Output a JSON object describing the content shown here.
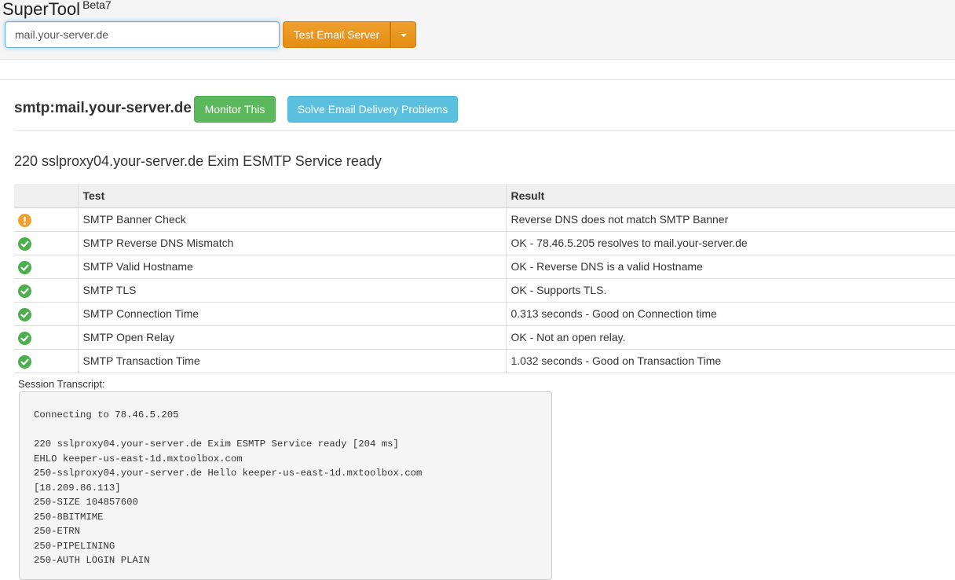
{
  "header": {
    "brand": "SuperTool",
    "brand_version": "Beta7",
    "search_value": "mail.your-server.de",
    "test_button_label": "Test Email Server"
  },
  "result": {
    "title": "smtp:mail.your-server.de",
    "monitor_button_label": "Monitor This",
    "solve_button_label": "Solve Email Delivery Problems",
    "banner": "220 sslproxy04.your-server.de Exim ESMTP Service ready"
  },
  "table": {
    "headers": [
      "",
      "Test",
      "Result"
    ],
    "rows": [
      {
        "status": "warning",
        "test": "SMTP Banner Check",
        "result": "Reverse DNS does not match SMTP Banner"
      },
      {
        "status": "ok",
        "test": "SMTP Reverse DNS Mismatch",
        "result": "OK - 78.46.5.205 resolves to mail.your-server.de"
      },
      {
        "status": "ok",
        "test": "SMTP Valid Hostname",
        "result": "OK - Reverse DNS is a valid Hostname"
      },
      {
        "status": "ok",
        "test": "SMTP TLS",
        "result": "OK - Supports TLS."
      },
      {
        "status": "ok",
        "test": "SMTP Connection Time",
        "result": "0.313 seconds - Good on Connection time"
      },
      {
        "status": "ok",
        "test": "SMTP Open Relay",
        "result": "OK - Not an open relay."
      },
      {
        "status": "ok",
        "test": "SMTP Transaction Time",
        "result": "1.032 seconds - Good on Transaction Time"
      }
    ]
  },
  "transcript": {
    "label": "Session Transcript:",
    "lines": [
      "Connecting to 78.46.5.205",
      "",
      "220 sslproxy04.your-server.de Exim ESMTP Service ready [204 ms]",
      "EHLO keeper-us-east-1d.mxtoolbox.com",
      "250-sslproxy04.your-server.de Hello keeper-us-east-1d.mxtoolbox.com",
      "[18.209.86.113]",
      "250-SIZE 104857600",
      "250-8BITMIME",
      "250-ETRN",
      "250-PIPELINING",
      "250-AUTH LOGIN PLAIN"
    ]
  },
  "colors": {
    "orange": "#e38d13",
    "green": "#5cb85c",
    "blue": "#5bc0de",
    "ok_icon": "#4cae4c",
    "warn_icon": "#f0a030"
  }
}
